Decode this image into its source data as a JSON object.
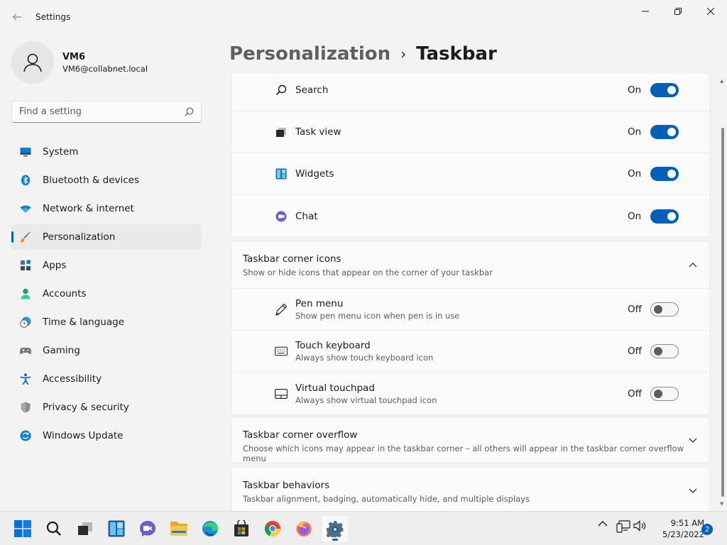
{
  "window": {
    "title": "Settings"
  },
  "profile": {
    "name": "VM6",
    "email": "VM6@collabnet.local"
  },
  "search": {
    "placeholder": "Find a setting"
  },
  "sidebar": {
    "items": [
      {
        "label": "System",
        "icon": "monitor-icon"
      },
      {
        "label": "Bluetooth & devices",
        "icon": "bluetooth-icon"
      },
      {
        "label": "Network & internet",
        "icon": "wifi-icon"
      },
      {
        "label": "Personalization",
        "icon": "brush-icon",
        "active": true
      },
      {
        "label": "Apps",
        "icon": "apps-icon"
      },
      {
        "label": "Accounts",
        "icon": "person-icon"
      },
      {
        "label": "Time & language",
        "icon": "clock-globe-icon"
      },
      {
        "label": "Gaming",
        "icon": "gamepad-icon"
      },
      {
        "label": "Accessibility",
        "icon": "accessibility-icon"
      },
      {
        "label": "Privacy & security",
        "icon": "shield-icon"
      },
      {
        "label": "Windows Update",
        "icon": "update-icon"
      }
    ]
  },
  "breadcrumb": {
    "parent": "Personalization",
    "separator": "›",
    "current": "Taskbar"
  },
  "taskbar_items": [
    {
      "label": "Search",
      "state": "On",
      "icon": "search-icon"
    },
    {
      "label": "Task view",
      "state": "On",
      "icon": "task-view-icon"
    },
    {
      "label": "Widgets",
      "state": "On",
      "icon": "widgets-icon"
    },
    {
      "label": "Chat",
      "state": "On",
      "icon": "chat-icon"
    }
  ],
  "corner_icons": {
    "title": "Taskbar corner icons",
    "description": "Show or hide icons that appear on the corner of your taskbar",
    "items": [
      {
        "label": "Pen menu",
        "description": "Show pen menu icon when pen is in use",
        "state": "Off",
        "icon": "pen-icon"
      },
      {
        "label": "Touch keyboard",
        "description": "Always show touch keyboard icon",
        "state": "Off",
        "icon": "keyboard-icon"
      },
      {
        "label": "Virtual touchpad",
        "description": "Always show virtual touchpad icon",
        "state": "Off",
        "icon": "touchpad-icon"
      }
    ]
  },
  "corner_overflow": {
    "title": "Taskbar corner overflow",
    "description": "Choose which icons may appear in the taskbar corner – all others will appear in the taskbar corner overflow menu"
  },
  "behaviors": {
    "title": "Taskbar behaviors",
    "description": "Taskbar alignment, badging, automatically hide, and multiple displays"
  },
  "clock": {
    "time": "9:51 AM",
    "date": "5/23/2022"
  },
  "notifications": {
    "count": "2"
  },
  "colors": {
    "accent": "#005fb8",
    "background": "#f3f3f3",
    "card": "#fbfbfb"
  }
}
